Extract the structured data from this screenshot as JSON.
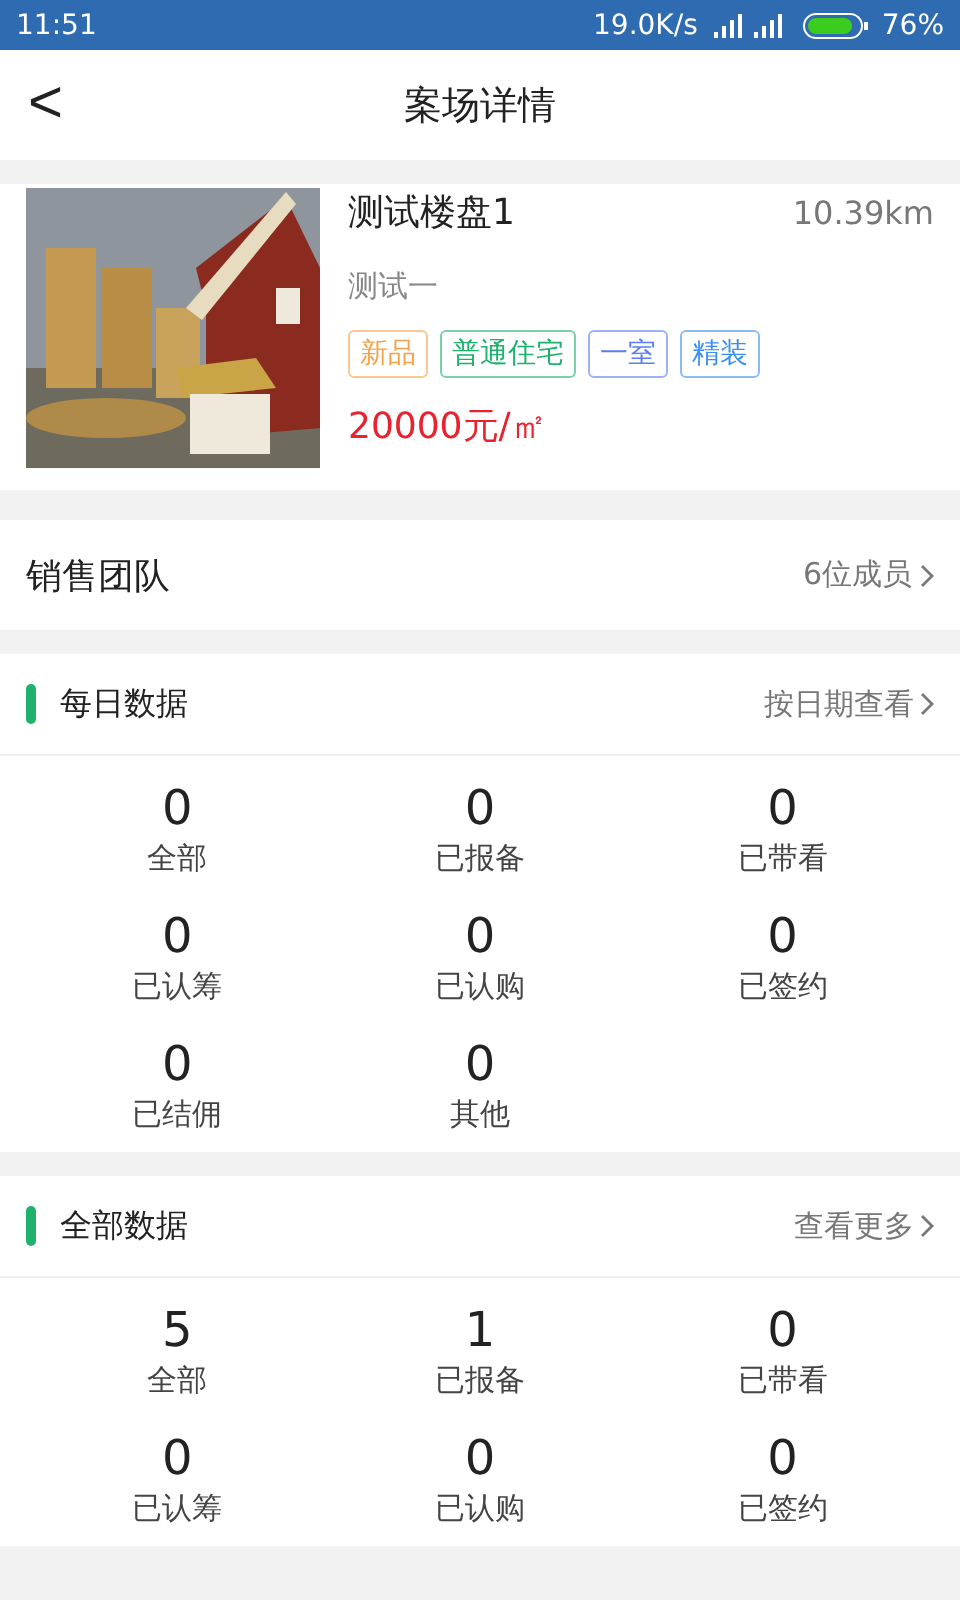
{
  "status_bar": {
    "time": "11:51",
    "speed": "19.0K/s",
    "battery": "76%"
  },
  "header": {
    "back": "<",
    "title": "案场详情"
  },
  "property": {
    "kind": "picture",
    "name": "测试楼盘1",
    "distance": "10.39km",
    "subtitle": "测试一",
    "tags": [
      {
        "label": "新品",
        "color": "#f5a34a"
      },
      {
        "label": "普通住宅",
        "color": "#1fb26c"
      },
      {
        "label": "一室",
        "color": "#5b7ff0"
      },
      {
        "label": "精装",
        "color": "#3b8ff0"
      }
    ],
    "price": "20000元/㎡"
  },
  "sales_team": {
    "label": "销售团队",
    "value": "6位成员"
  },
  "sections": [
    {
      "title": "每日数据",
      "link": "按日期查看",
      "stats": [
        {
          "value": "0",
          "label": "全部"
        },
        {
          "value": "0",
          "label": "已报备"
        },
        {
          "value": "0",
          "label": "已带看"
        },
        {
          "value": "0",
          "label": "已认筹"
        },
        {
          "value": "0",
          "label": "已认购"
        },
        {
          "value": "0",
          "label": "已签约"
        },
        {
          "value": "0",
          "label": "已结佣"
        },
        {
          "value": "0",
          "label": "其他"
        }
      ]
    },
    {
      "title": "全部数据",
      "link": "查看更多",
      "stats": [
        {
          "value": "5",
          "label": "全部"
        },
        {
          "value": "1",
          "label": "已报备"
        },
        {
          "value": "0",
          "label": "已带看"
        },
        {
          "value": "0",
          "label": "已认筹"
        },
        {
          "value": "0",
          "label": "已认购"
        },
        {
          "value": "0",
          "label": "已签约"
        }
      ]
    }
  ]
}
